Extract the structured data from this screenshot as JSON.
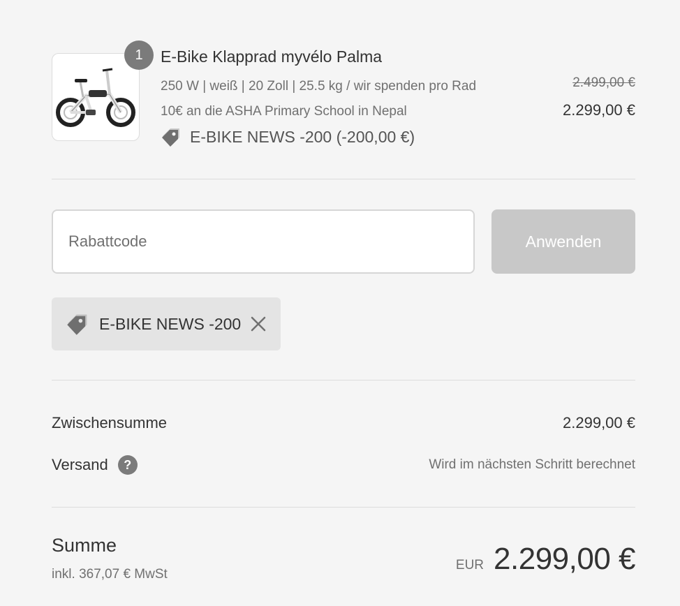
{
  "product": {
    "quantity": "1",
    "title": "E-Bike Klapprad myvélo Palma",
    "desc_line1": "250 W | weiß | 20 Zoll | 25.5 kg / wir spenden pro Rad",
    "desc_line2": "10€ an die ASHA Primary School in Nepal",
    "discount": "E-BIKE NEWS -200 (-200,00 €)",
    "price_original": "2.499,00 €",
    "price_current": "2.299,00 €",
    "image_icon": "folding-ebike-image"
  },
  "discount_form": {
    "placeholder": "Rabattcode",
    "value": "",
    "apply_label": "Anwenden"
  },
  "applied_code": {
    "label": "E-BIKE NEWS -200",
    "icon": "tag-icon",
    "remove_icon": "close-icon"
  },
  "summary": {
    "subtotal_label": "Zwischensumme",
    "subtotal_value": "2.299,00 €",
    "shipping_label": "Versand",
    "shipping_help_icon": "question-icon",
    "shipping_value": "Wird im nächsten Schritt berechnet",
    "total_label": "Summe",
    "tax_note": "inkl. 367,07 € MwSt",
    "currency": "EUR",
    "total_value": "2.299,00 €"
  },
  "colors": {
    "background": "#f5f5f5",
    "badge": "#7b7b7b",
    "button_disabled": "#c8c8c8",
    "chip": "#e4e4e4"
  }
}
